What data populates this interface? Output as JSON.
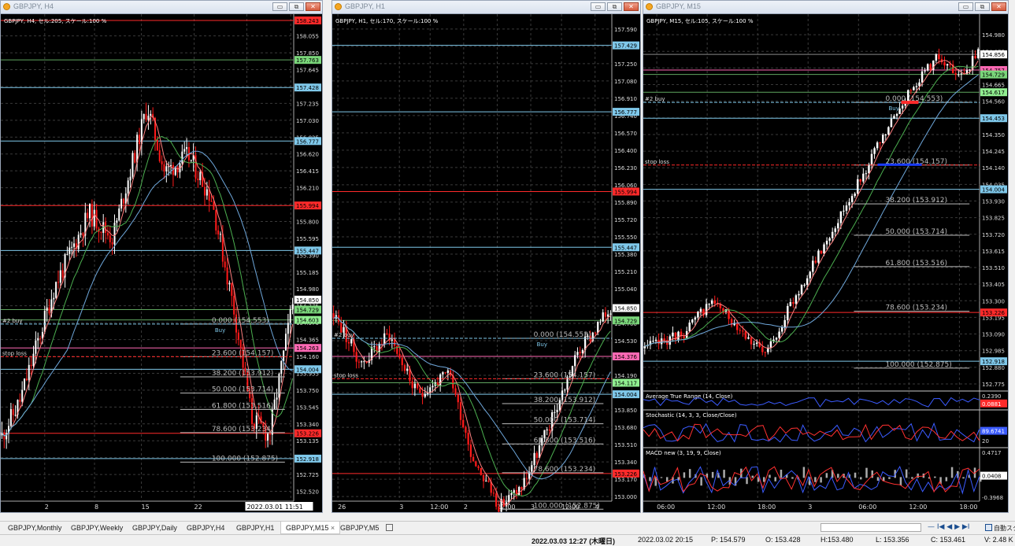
{
  "windows": [
    {
      "id": "h4",
      "title": "GBPJPY, H4",
      "header": "GBPJPY, H4, セル:205, スケール:100 %",
      "y_min": 152.42,
      "y_max": 158.3,
      "price_ticks": [
        "158.055",
        "157.850",
        "157.645",
        "157.440",
        "157.235",
        "157.030",
        "156.825",
        "156.620",
        "156.415",
        "156.210",
        "156.005",
        "155.800",
        "155.595",
        "155.390",
        "155.185",
        "154.980",
        "154.775",
        "154.570",
        "154.365",
        "154.160",
        "153.955",
        "153.750",
        "153.545",
        "153.340",
        "153.135",
        "152.930",
        "152.725",
        "152.520"
      ],
      "x_ticks": [
        {
          "label": "2",
          "pos": 0.15
        },
        {
          "label": "8",
          "pos": 0.32
        },
        {
          "label": "15",
          "pos": 0.48
        },
        {
          "label": "22",
          "pos": 0.66
        },
        {
          "label": "2022.03.01 11:51",
          "pos": 0.84,
          "boxed": true
        },
        {
          "label": "4",
          "pos": 0.99
        }
      ],
      "hlines": [
        {
          "price": 158.243,
          "color": "#ff2a2a",
          "label": "158.243",
          "badge": "#ff2a2a"
        },
        {
          "price": 157.763,
          "color": "#5fa55f",
          "label": "157.763",
          "badge": "#7ad67a"
        },
        {
          "price": 157.428,
          "color": "#7fc8ea",
          "label": "157.428",
          "badge": "#7fc8ea"
        },
        {
          "price": 156.777,
          "color": "#7fc8ea",
          "label": "156.777",
          "badge": "#7fc8ea"
        },
        {
          "price": 155.994,
          "color": "#ff2a2a",
          "label": "155.994",
          "badge": "#ff2a2a"
        },
        {
          "price": 155.447,
          "color": "#7fc8ea",
          "label": "155.447",
          "badge": "#7fc8ea"
        },
        {
          "price": 154.729,
          "color": "#5fa55f",
          "label": "154.729",
          "badge": "#7ad67a"
        },
        {
          "price": 154.603,
          "color": "#5fa55f",
          "label": "154.603",
          "badge": "#90ee90"
        },
        {
          "price": 154.263,
          "color": "#ff69b4",
          "label": "154.263",
          "badge": "#ff69b4"
        },
        {
          "price": 154.004,
          "color": "#7fc8ea",
          "label": "154.004",
          "badge": "#7fc8ea"
        },
        {
          "price": 153.226,
          "color": "#ff2a2a",
          "label": "153.226",
          "badge": "#ff2a2a"
        },
        {
          "price": 152.918,
          "color": "#7fc8ea",
          "label": "152.918",
          "badge": "#7fc8ea"
        }
      ],
      "last_price": "154.850",
      "buy_label": "#2 buy",
      "buy_price": 154.553,
      "stop_label": "stop loss",
      "stop_price": 154.157,
      "fib": [
        {
          "text": "0.000 (154.553)",
          "price": 154.553
        },
        {
          "text": "23.600 (154.157)",
          "price": 154.157
        },
        {
          "text": "38.200 (153.912)",
          "price": 153.912
        },
        {
          "text": "50.000 (153.714)",
          "price": 153.714
        },
        {
          "text": "61.800 (153.516)",
          "price": 153.516
        },
        {
          "text": "78.600 (153.234)",
          "price": 153.234
        },
        {
          "text": "100.000 (152.875)",
          "price": 152.875
        }
      ]
    },
    {
      "id": "h1",
      "title": "GBPJPY, H1",
      "header": "GBPJPY, H1, セル:170, スケール:100 %",
      "y_min": 152.97,
      "y_max": 157.72,
      "price_ticks": [
        "157.590",
        "157.420",
        "157.250",
        "157.080",
        "156.910",
        "156.740",
        "156.570",
        "156.400",
        "156.230",
        "156.060",
        "155.890",
        "155.720",
        "155.550",
        "155.380",
        "155.210",
        "155.040",
        "154.870",
        "154.700",
        "154.530",
        "154.360",
        "154.190",
        "154.020",
        "153.850",
        "153.680",
        "153.510",
        "153.340",
        "153.170",
        "153.000"
      ],
      "x_ticks": [
        {
          "label": "26",
          "pos": 0.02
        },
        {
          "label": "3",
          "pos": 0.24
        },
        {
          "label": "12:00",
          "pos": 0.35
        },
        {
          "label": "2",
          "pos": 0.47
        },
        {
          "label": "12:00",
          "pos": 0.59
        },
        {
          "label": "3",
          "pos": 0.71
        },
        {
          "label": "12:00",
          "pos": 0.82
        },
        {
          "label": "4",
          "pos": 0.94
        }
      ],
      "hlines": [
        {
          "price": 157.429,
          "color": "#7fc8ea",
          "label": "157.429",
          "badge": "#7fc8ea"
        },
        {
          "price": 156.777,
          "color": "#7fc8ea",
          "label": "156.777",
          "badge": "#7fc8ea"
        },
        {
          "price": 155.994,
          "color": "#ff2a2a",
          "label": "155.994",
          "badge": "#ff2a2a"
        },
        {
          "price": 155.447,
          "color": "#7fc8ea",
          "label": "155.447",
          "badge": "#7fc8ea"
        },
        {
          "price": 154.729,
          "color": "#5fa55f",
          "label": "154.729",
          "badge": "#7ad67a"
        },
        {
          "price": 154.376,
          "color": "#ff69b4",
          "label": "154.376",
          "badge": "#ff69b4"
        },
        {
          "price": 154.117,
          "color": "#5fa55f",
          "label": "154.117",
          "badge": "#90ee90"
        },
        {
          "price": 154.004,
          "color": "#7fc8ea",
          "label": "154.004",
          "badge": "#7fc8ea"
        },
        {
          "price": 153.226,
          "color": "#ff2a2a",
          "label": "153.226",
          "badge": "#ff2a2a"
        }
      ],
      "last_price": "154.850",
      "buy_label": "#2 buy",
      "buy_price": 154.553,
      "stop_label": "stop loss",
      "stop_price": 154.157,
      "fib": [
        {
          "text": "0.000 (154.553)",
          "price": 154.553
        },
        {
          "text": "23.600 (154.157)",
          "price": 154.157
        },
        {
          "text": "38.200 (153.912)",
          "price": 153.912
        },
        {
          "text": "50.000 (153.714)",
          "price": 153.714
        },
        {
          "text": "61.800 (153.516)",
          "price": 153.516
        },
        {
          "text": "78.600 (153.234)",
          "price": 153.234
        },
        {
          "text": "100.000 (152.875)",
          "price": 152.875
        }
      ]
    },
    {
      "id": "m15",
      "title": "GBPJPY, M15",
      "header": "GBPJPY, M15, セル:105, スケール:100 %",
      "y_min": 152.74,
      "y_max": 155.1,
      "price_ticks": [
        "154.980",
        "154.875",
        "154.770",
        "154.665",
        "154.560",
        "154.455",
        "154.350",
        "154.245",
        "154.140",
        "154.035",
        "153.930",
        "153.825",
        "153.720",
        "153.615",
        "153.510",
        "153.405",
        "153.300",
        "153.195",
        "153.090",
        "152.985",
        "152.880",
        "152.775"
      ],
      "x_ticks": [
        {
          "label": "06:00",
          "pos": 0.04
        },
        {
          "label": "12:00",
          "pos": 0.19
        },
        {
          "label": "18:00",
          "pos": 0.34
        },
        {
          "label": "3",
          "pos": 0.49
        },
        {
          "label": "06:00",
          "pos": 0.64
        },
        {
          "label": "12:00",
          "pos": 0.79
        },
        {
          "label": "18:00",
          "pos": 0.94
        }
      ],
      "hlines": [
        {
          "price": 154.856,
          "color": "#888888",
          "label": "154.856",
          "badge": "#ffffff"
        },
        {
          "price": 154.757,
          "color": "#ff69b4",
          "label": "154.757",
          "badge": "#ff69b4"
        },
        {
          "price": 154.729,
          "color": "#5fa55f",
          "label": "154.729",
          "badge": "#7ad67a"
        },
        {
          "price": 154.617,
          "color": "#5fa55f",
          "label": "154.617",
          "badge": "#90ee90"
        },
        {
          "price": 154.453,
          "color": "#7fc8ea",
          "label": "154.453",
          "badge": "#7fc8ea"
        },
        {
          "price": 154.004,
          "color": "#7fc8ea",
          "label": "154.004",
          "badge": "#7fc8ea"
        },
        {
          "price": 153.226,
          "color": "#ff2a2a",
          "label": "153.226",
          "badge": "#ff2a2a"
        },
        {
          "price": 152.918,
          "color": "#7fc8ea",
          "label": "152.918",
          "badge": "#7fc8ea"
        }
      ],
      "last_price": "154.856",
      "buy_label": "#2 buy",
      "buy_price": 154.553,
      "stop_label": "stop loss",
      "stop_price": 154.157,
      "fib": [
        {
          "text": "0.000 (154.553)",
          "price": 154.553
        },
        {
          "text": "23.600 (154.157)",
          "price": 154.157
        },
        {
          "text": "38.200 (153.912)",
          "price": 153.912
        },
        {
          "text": "50.000 (153.714)",
          "price": 153.714
        },
        {
          "text": "61.800 (153.516)",
          "price": 153.516
        },
        {
          "text": "78.600 (153.234)",
          "price": 153.234
        },
        {
          "text": "100.000 (152.875)",
          "price": 152.875
        }
      ],
      "atr": {
        "title": "Average True Range (14, Close)",
        "top": "0.2390",
        "value": "0.0881"
      },
      "stoch": {
        "title": "Stochastic (14, 3, 3, Close/Close)",
        "value": "89.6741",
        "level": "20"
      },
      "macd": {
        "title": "MACD new (3, 19, 9, Close)",
        "top": "0.4717",
        "value": "0.0408",
        "bottom": "-0.3968"
      }
    }
  ],
  "buy_marker": "Buy",
  "win_buttons": {
    "minimize": "▭",
    "restore": "⧉",
    "close": "✕"
  },
  "tabs": [
    {
      "label": "GBPJPY,Monthly"
    },
    {
      "label": "GBPJPY,Weekly"
    },
    {
      "label": "GBPJPY,Daily"
    },
    {
      "label": "GBPJPY,H4"
    },
    {
      "label": "GBPJPY,H1"
    },
    {
      "label": "GBPJPY,M15",
      "active": true
    },
    {
      "label": "GBPJPY,M5"
    }
  ],
  "tab_close": "×",
  "nav_controls": "— I◀ ◀ ▶ ▶I",
  "nav_icon_label": "自動スク",
  "status": {
    "datetime": "2022.03.03 12:27 (木曜日)",
    "bar_time": "2022.03.02 20:15",
    "p": "P: 154.579",
    "o": "O: 153.428",
    "h": "H:153.480",
    "l": "L: 153.356",
    "c": "C: 153.461",
    "v": "V: 2.48 K"
  },
  "colors": {
    "bull": "#ffffff",
    "bear": "#ff1a1a",
    "grid": "#3a3a3a",
    "ma1": "#ff7f7f",
    "ma2": "#4caf50",
    "ma3": "#6fa8dc"
  }
}
